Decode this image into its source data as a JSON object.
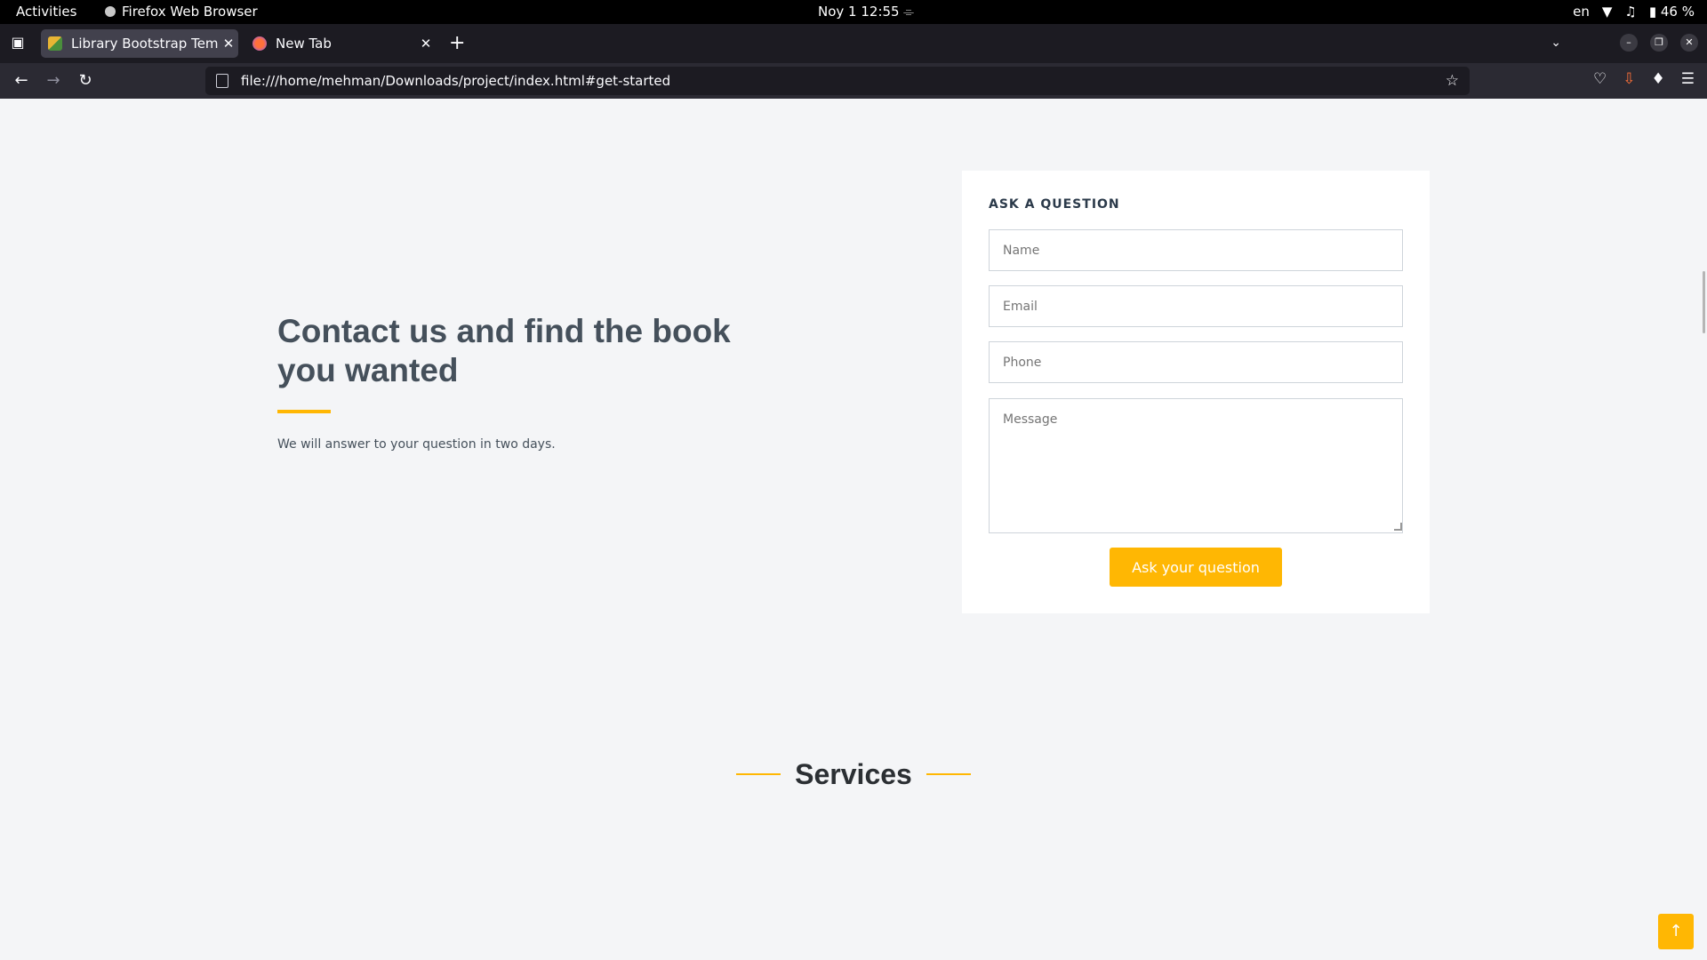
{
  "system_bar": {
    "activities": "Activities",
    "app_name": "Firefox Web Browser",
    "datetime": "Noy 1  12:55",
    "language": "en",
    "battery": "46 %"
  },
  "browser": {
    "tabs": [
      {
        "label": "Library Bootstrap Templ",
        "active": true
      },
      {
        "label": "New Tab",
        "active": false
      }
    ],
    "url": "file:///home/mehman/Downloads/project/index.html#get-started"
  },
  "cta": {
    "title": "Contact us and find the book you wanted",
    "subtitle": "We will answer to your question in two days."
  },
  "form": {
    "heading": "ASK A QUESTION",
    "name_placeholder": "Name",
    "email_placeholder": "Email",
    "phone_placeholder": "Phone",
    "message_placeholder": "Message",
    "submit_label": "Ask your question"
  },
  "services": {
    "title": "Services"
  },
  "colors": {
    "accent": "#ffb703",
    "heading": "#45505b",
    "background": "#f4f5f7"
  },
  "icons": {
    "back_to_top": "arrow-up-icon"
  }
}
